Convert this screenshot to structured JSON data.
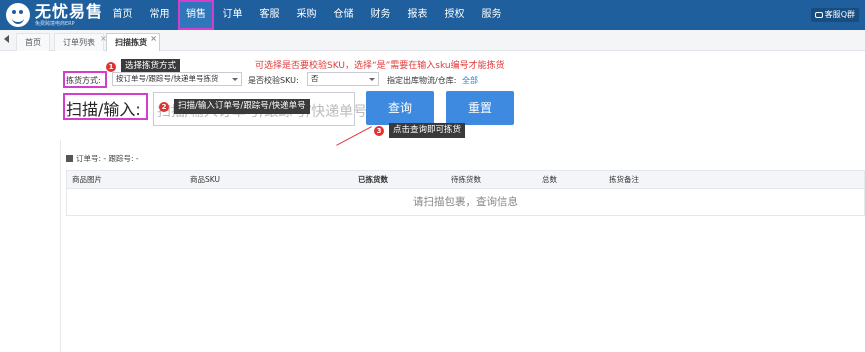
{
  "app": {
    "title": "无忧易售",
    "subtitle": "免费跨境电商ERP",
    "service_label": "客服Q群"
  },
  "nav": {
    "items": [
      "首页",
      "常用",
      "销售",
      "订单",
      "客服",
      "采购",
      "仓储",
      "财务",
      "报表",
      "授权",
      "服务"
    ],
    "active": "销售"
  },
  "tabs": {
    "items": [
      {
        "label": "首页"
      },
      {
        "label": "订单列表"
      },
      {
        "label": "扫描拣货",
        "close": "×"
      }
    ],
    "extra_close": "×"
  },
  "form": {
    "pick_mode_label": "拣货方式:",
    "pick_mode_value": "按订单号/跟踪号/快递单号拣货",
    "verify_sku_label": "是否校验SKU:",
    "verify_sku_value": "否",
    "warehouse_label": "指定出库物流/仓库:",
    "warehouse_value": "全部",
    "scan_label": "扫描/输入:",
    "scan_placeholder": "扫描/输入订单号/跟踪号/快递单号",
    "query_button": "查询",
    "reset_button": "重置"
  },
  "annotations": {
    "tip1": {
      "num": "1",
      "text": "选择拣货方式"
    },
    "tip2": {
      "num": "2",
      "text": "扫描/输入订单号/跟踪号/快递单号"
    },
    "tip3": {
      "num": "3",
      "text": "点击查询即可拣货"
    },
    "red_note": "可选择是否要校验SKU，选择“是”需要在输入sku编号才能拣货"
  },
  "order_info": {
    "text": "订单号: - 跟踪号: -"
  },
  "table": {
    "columns": [
      "商品图片",
      "商品SKU",
      "已拣货数",
      "待拣货数",
      "总数",
      "拣货备注"
    ],
    "empty_text": "请扫描包裹，查询信息"
  },
  "colors": {
    "topbar": "#1f5f9e",
    "highlight": "#d23fcf",
    "annotation_red": "#e03a3a",
    "button": "#3d8ae0"
  }
}
